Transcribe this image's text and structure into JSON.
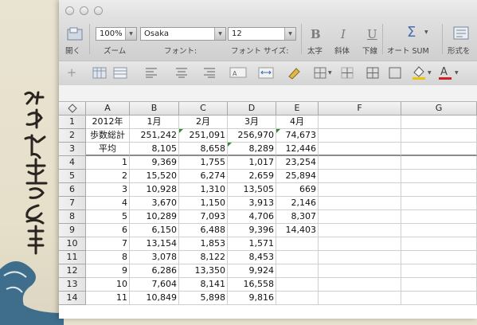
{
  "toolbar": {
    "zoom_value": "100%",
    "font_value": "Osaka",
    "size_value": "12",
    "labels": {
      "open": "開く",
      "zoom": "ズーム",
      "font": "フォント:",
      "font_size": "フォント サイズ:",
      "bold": "太字",
      "italic": "斜体",
      "underline": "下線",
      "autosum": "オート SUM",
      "format": "形式を"
    },
    "glyphs": {
      "bold": "B",
      "italic": "I",
      "underline": "U",
      "sigma": "Σ"
    }
  },
  "sheet": {
    "columns": [
      "A",
      "B",
      "C",
      "D",
      "E",
      "F",
      "G"
    ],
    "rows": [
      {
        "n": "1",
        "cells": [
          "2012年",
          "1月",
          "2月",
          "3月",
          "4月"
        ],
        "align": "ctr"
      },
      {
        "n": "2",
        "cells": [
          "歩数総計",
          "251,242",
          "251,091",
          "256,970",
          "74,673"
        ],
        "align": "num"
      },
      {
        "n": "3",
        "cells": [
          "平均",
          "8,105",
          "8,658",
          "8,289",
          "12,446"
        ],
        "align": "num"
      },
      {
        "n": "4",
        "cells": [
          "1",
          "9,369",
          "1,755",
          "1,017",
          "23,254"
        ],
        "align": "num"
      },
      {
        "n": "5",
        "cells": [
          "2",
          "15,520",
          "6,274",
          "2,659",
          "25,894"
        ],
        "align": "num"
      },
      {
        "n": "6",
        "cells": [
          "3",
          "10,928",
          "1,310",
          "13,505",
          "669"
        ],
        "align": "num"
      },
      {
        "n": "7",
        "cells": [
          "4",
          "3,670",
          "1,150",
          "3,913",
          "2,146"
        ],
        "align": "num"
      },
      {
        "n": "8",
        "cells": [
          "5",
          "10,289",
          "7,093",
          "4,706",
          "8,307"
        ],
        "align": "num"
      },
      {
        "n": "9",
        "cells": [
          "6",
          "6,150",
          "6,488",
          "9,396",
          "14,403"
        ],
        "align": "num"
      },
      {
        "n": "10",
        "cells": [
          "7",
          "13,154",
          "1,853",
          "1,571",
          ""
        ],
        "align": "num"
      },
      {
        "n": "11",
        "cells": [
          "8",
          "3,078",
          "8,122",
          "8,453",
          ""
        ],
        "align": "num"
      },
      {
        "n": "12",
        "cells": [
          "9",
          "6,286",
          "13,350",
          "9,924",
          ""
        ],
        "align": "num"
      },
      {
        "n": "13",
        "cells": [
          "10",
          "7,604",
          "8,141",
          "16,558",
          ""
        ],
        "align": "num"
      },
      {
        "n": "14",
        "cells": [
          "11",
          "10,849",
          "5,898",
          "9,816",
          ""
        ],
        "align": "num"
      }
    ]
  },
  "colors": {
    "comment_marker": "#2d8a2d",
    "autosum_blue": "#4a6fb0",
    "fill_yellow": "#e8c800",
    "font_red": "#cc2222"
  }
}
